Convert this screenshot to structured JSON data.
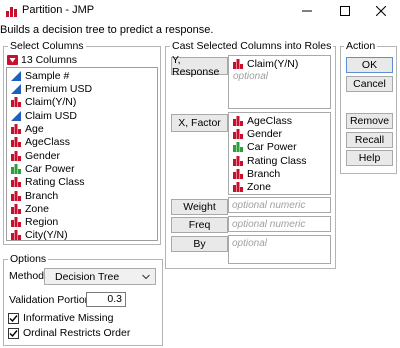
{
  "window": {
    "title": "Partition - JMP"
  },
  "subtitle": "Builds a decision tree to predict a response.",
  "select_columns": {
    "label": "Select Columns",
    "count_label": "13 Columns",
    "columns": [
      {
        "name": "Sample #",
        "type": "continuous"
      },
      {
        "name": "Premium USD",
        "type": "continuous"
      },
      {
        "name": "Claim(Y/N)",
        "type": "nominal"
      },
      {
        "name": "Claim USD",
        "type": "continuous"
      },
      {
        "name": "Age",
        "type": "nominal"
      },
      {
        "name": "AgeClass",
        "type": "nominal"
      },
      {
        "name": "Gender",
        "type": "nominal"
      },
      {
        "name": "Car Power",
        "type": "ordinal"
      },
      {
        "name": "Rating Class",
        "type": "nominal"
      },
      {
        "name": "Branch",
        "type": "nominal"
      },
      {
        "name": "Zone",
        "type": "nominal"
      },
      {
        "name": "Region",
        "type": "nominal"
      },
      {
        "name": "City(Y/N)",
        "type": "nominal"
      }
    ]
  },
  "cast_roles": {
    "label": "Cast Selected Columns into Roles",
    "y_response": {
      "button": "Y, Response",
      "items": [
        {
          "name": "Claim(Y/N)",
          "type": "nominal"
        }
      ],
      "hint": "optional"
    },
    "x_factor": {
      "button": "X, Factor",
      "items": [
        {
          "name": "AgeClass",
          "type": "nominal"
        },
        {
          "name": "Gender",
          "type": "nominal"
        },
        {
          "name": "Car Power",
          "type": "ordinal"
        },
        {
          "name": "Rating Class",
          "type": "nominal"
        },
        {
          "name": "Branch",
          "type": "nominal"
        },
        {
          "name": "Zone",
          "type": "nominal"
        }
      ]
    },
    "weight": {
      "button": "Weight",
      "hint": "optional numeric"
    },
    "freq": {
      "button": "Freq",
      "hint": "optional numeric"
    },
    "by": {
      "button": "By",
      "hint": "optional"
    }
  },
  "action": {
    "label": "Action",
    "ok": "OK",
    "cancel": "Cancel",
    "remove": "Remove",
    "recall": "Recall",
    "help": "Help"
  },
  "options": {
    "label": "Options",
    "method_label": "Method",
    "method_value": "Decision Tree",
    "validation_label": "Validation Portion",
    "validation_value": "0.3",
    "informative_missing": {
      "label": "Informative Missing",
      "checked": true
    },
    "ordinal_restricts": {
      "label": "Ordinal Restricts Order",
      "checked": true
    }
  },
  "colors": {
    "nominal": "#c8102e",
    "continuous": "#1f5fbf",
    "ordinal": "#2e9e3a",
    "default_button_border": "#5b8fd6"
  }
}
